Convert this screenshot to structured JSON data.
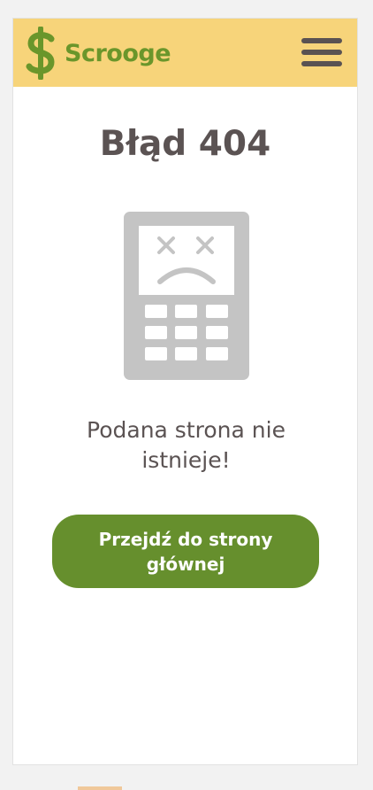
{
  "header": {
    "brand": "Scrooge",
    "logo_icon": "dollar-sign-icon",
    "menu_icon": "hamburger-menu-icon",
    "background_color": "#f7d47a",
    "brand_color": "#6a962b"
  },
  "main": {
    "title": "Błąd 404",
    "illustration_icon": "sad-phone-icon",
    "message": "Podana strona nie istnieje!",
    "home_button_label": "Przejdź do strony głównej",
    "button_color": "#668f2d"
  }
}
